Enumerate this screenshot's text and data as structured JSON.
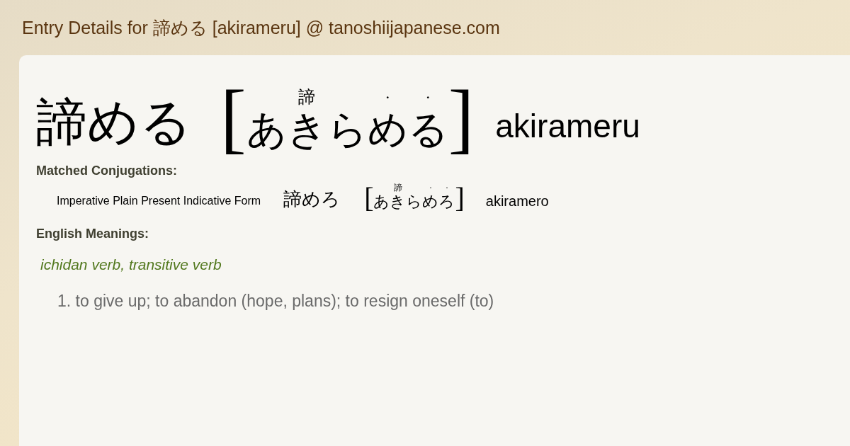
{
  "page_title": "Entry Details for 諦める [akirameru] @ tanoshiijapanese.com",
  "entry": {
    "word": "諦める",
    "bracket_open": "[",
    "bracket_close": "]",
    "reading": [
      {
        "kana": "あきら",
        "mark": "諦"
      },
      {
        "kana": "め",
        "mark": "·"
      },
      {
        "kana": "る",
        "mark": "·"
      }
    ],
    "romaji": "akirameru"
  },
  "conjugations": {
    "heading": "Matched Conjugations:",
    "items": [
      {
        "form": "Imperative Plain Present Indicative Form",
        "word": "諦めろ",
        "bracket_open": "[",
        "bracket_close": "]",
        "reading": [
          {
            "kana": "あきら",
            "mark": "諦"
          },
          {
            "kana": "め",
            "mark": "·"
          },
          {
            "kana": "ろ",
            "mark": "·"
          }
        ],
        "romaji": "akiramero"
      }
    ]
  },
  "meanings": {
    "heading": "English Meanings:",
    "part_of_speech": "ichidan verb, transitive verb",
    "senses": [
      "1. to give up; to abandon (hope, plans); to resign oneself (to)"
    ]
  }
}
